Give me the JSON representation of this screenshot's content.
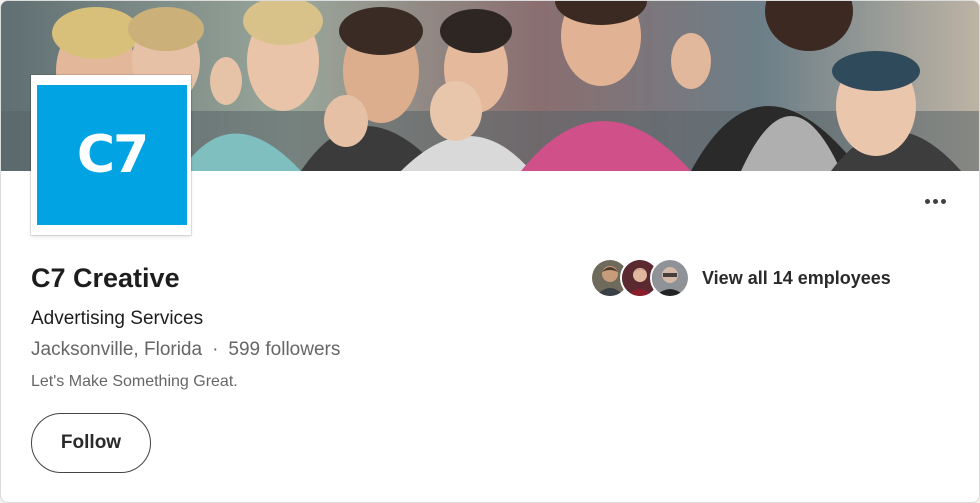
{
  "company": {
    "logo_text": "C7",
    "logo_color": "#02a3e3",
    "name": "C7 Creative",
    "industry": "Advertising Services",
    "location": "Jacksonville, Florida",
    "separator": "·",
    "followers": "599 followers",
    "tagline": "Let's Make Something Great."
  },
  "actions": {
    "follow_label": "Follow",
    "more_icon": "ellipsis-horizontal-icon"
  },
  "employees": {
    "label": "View all 14 employees"
  }
}
